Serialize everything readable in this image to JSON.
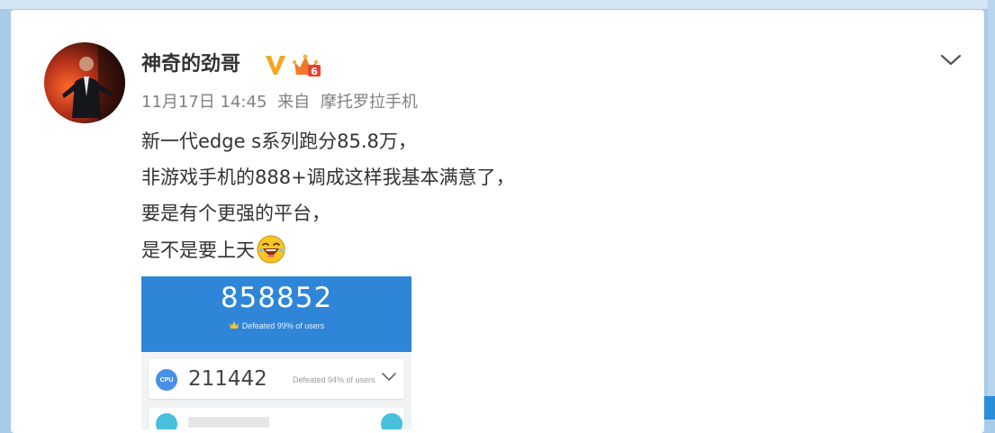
{
  "post": {
    "username": "神奇的劲哥",
    "date": "11月17日 14:45",
    "source_prefix": "来自",
    "source": "摩托罗拉手机",
    "lines": [
      "新一代edge s系列跑分85.8万，",
      "非游戏手机的888+调成这样我基本满意了，",
      "要是有个更强的平台，",
      "是不是要上天"
    ]
  },
  "badges": {
    "verified": "V",
    "vip_level": "6"
  },
  "icons": {
    "menu": "chevron-down-icon",
    "verified": "verified-v-icon",
    "vip": "vip-crown-icon",
    "emoji": "laughing-emoji-icon"
  },
  "screenshot": {
    "total_score": "858852",
    "total_defeated": "Defeated 99% of users",
    "cpu_label": "CPU",
    "cpu_score": "211442",
    "cpu_defeated": "Defeated 94% of users"
  },
  "colors": {
    "background": "#a8cbe8",
    "card": "#ffffff",
    "text": "#333333",
    "meta": "#808080",
    "verified_badge": "#f5a623",
    "benchmark_blue": "#2f86d8"
  }
}
